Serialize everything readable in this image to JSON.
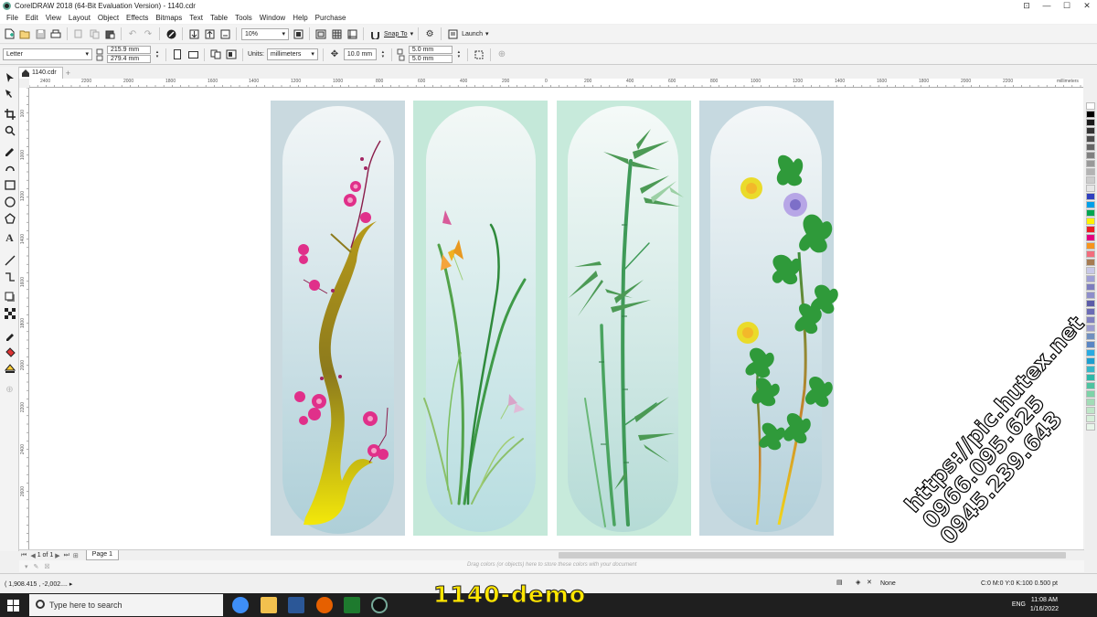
{
  "window": {
    "title": "CorelDRAW 2018 (64-Bit Evaluation Version) - 1140.cdr",
    "controls": [
      "⊡",
      "—",
      "☐",
      "✕"
    ]
  },
  "menu": [
    "File",
    "Edit",
    "View",
    "Layout",
    "Object",
    "Effects",
    "Bitmaps",
    "Text",
    "Table",
    "Tools",
    "Window",
    "Help",
    "Purchase"
  ],
  "toolbar": {
    "zoom_value": "10%",
    "snap_label": "Snap To",
    "launch_label": "Launch"
  },
  "property_bar": {
    "page_size": "Letter",
    "width": "215.9 mm",
    "height": "279.4 mm",
    "units_label": "Units:",
    "units_value": "millimeters",
    "nudge": "10.0 mm",
    "dup_x": "5.0 mm",
    "dup_y": "5.0 mm"
  },
  "doc_tab": {
    "label": "1140.cdr",
    "add": "+"
  },
  "ruler": {
    "h_labels": [
      "2400",
      "2200",
      "2000",
      "1800",
      "1600",
      "1400",
      "1200",
      "1000",
      "800",
      "600",
      "400",
      "200",
      "0",
      "200",
      "400",
      "600",
      "800",
      "1000",
      "1200",
      "1400",
      "1600",
      "1800",
      "2000",
      "2200"
    ],
    "h_unit": "millimeters",
    "v_labels": [
      "100",
      "1000",
      "1200",
      "1400",
      "1600",
      "1800",
      "2000",
      "2200",
      "2400",
      "2600"
    ]
  },
  "canvas": {
    "panels": [
      {
        "name": "plum-blossom",
        "bg": "#c9d9df",
        "arch_top": "#f2f6f7",
        "arch_bottom": "#aecfd8"
      },
      {
        "name": "orchid",
        "bg": "#c4e8d9",
        "arch_top": "#f3f8f6",
        "arch_bottom": "#b7dde0"
      },
      {
        "name": "bamboo",
        "bg": "#c7eadb",
        "arch_top": "#f5faf8",
        "arch_bottom": "#b5dbd6"
      },
      {
        "name": "chrysanthemum",
        "bg": "#c6d9e0",
        "arch_top": "#f4f7f8",
        "arch_bottom": "#b3d0da"
      }
    ]
  },
  "palette": [
    "#ffffff",
    "#000000",
    "#1a1a1a",
    "#333333",
    "#4d4d4d",
    "#666666",
    "#808080",
    "#999999",
    "#b3b3b3",
    "#cccccc",
    "#e6e6e6",
    "#2f3fbf",
    "#00a0e9",
    "#00a650",
    "#fff200",
    "#ed1c24",
    "#e4007f",
    "#f7941d",
    "#f26d7d",
    "#a67c52",
    "#c8c8e8",
    "#9f9fd6",
    "#7d7dbf",
    "#8e8ecb",
    "#5c5ca8",
    "#6b6bb5",
    "#8080c0",
    "#9c9cd0",
    "#7090c0",
    "#5a86c4",
    "#29abe2",
    "#1d9fd0",
    "#35b7c8",
    "#2cb8a8",
    "#4ec3a0",
    "#7dd3a8",
    "#a2dcb6",
    "#bfe6c8",
    "#d6efda",
    "#e8f6ea"
  ],
  "pagebar": {
    "page_count": "1 of 1",
    "page_tab": "Page 1"
  },
  "colorbar": {
    "hint": "Drag colors (or objects) here to store these colors with your document"
  },
  "status": {
    "coords": "( 1,908.415 , -2,002.... ▸",
    "fill": "None",
    "stroke": "C:0 M:0 Y:0 K:100  0.500 pt"
  },
  "taskbar": {
    "search_placeholder": "Type here to search",
    "lang": "ENG",
    "time": "11:08 AM",
    "date": "1/16/2022"
  },
  "overlay": {
    "demo_label": "1140-demo",
    "wm_url": "https://pic.hutex.net",
    "wm_phone1": "0966.095.625",
    "wm_phone2": "0945.239.643"
  }
}
